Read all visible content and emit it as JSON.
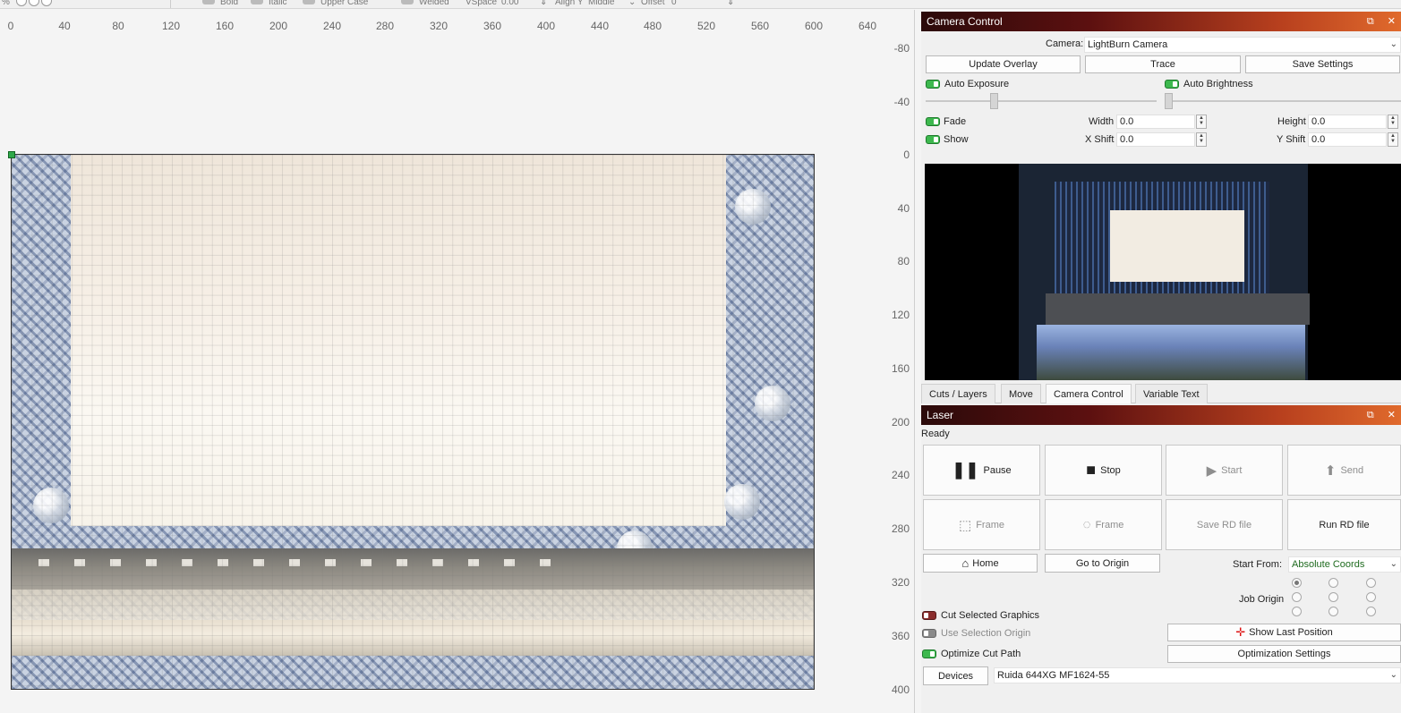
{
  "toolbar": {
    "bold": "Bold",
    "italic": "Italic",
    "upper_case": "Upper Case",
    "welded": "Welded",
    "vspace_label": "VSpace",
    "vspace_value": "0.00",
    "align_y_label": "Align Y",
    "align_y_value": "Middle",
    "offset_label": "Offset",
    "offset_value": "0"
  },
  "ruler_x": [
    "0",
    "40",
    "80",
    "120",
    "160",
    "200",
    "240",
    "280",
    "320",
    "360",
    "400",
    "440",
    "480",
    "520",
    "560",
    "600",
    "640"
  ],
  "ruler_y": [
    "-80",
    "-40",
    "0",
    "40",
    "80",
    "120",
    "160",
    "200",
    "240",
    "280",
    "320",
    "360",
    "400"
  ],
  "camera_control": {
    "title": "Camera Control",
    "camera_label": "Camera:",
    "camera_value": "LightBurn Camera",
    "update_overlay": "Update Overlay",
    "trace": "Trace",
    "save_settings": "Save Settings",
    "auto_exposure": "Auto Exposure",
    "auto_brightness": "Auto Brightness",
    "fade": "Fade",
    "show": "Show",
    "width_label": "Width",
    "width_value": "0.0",
    "height_label": "Height",
    "height_value": "0.0",
    "xshift_label": "X Shift",
    "xshift_value": "0.0",
    "yshift_label": "Y Shift",
    "yshift_value": "0.0"
  },
  "tabs": [
    "Cuts / Layers",
    "Move",
    "Camera Control",
    "Variable Text"
  ],
  "laser": {
    "title": "Laser",
    "status": "Ready",
    "pause": "Pause",
    "stop": "Stop",
    "start": "Start",
    "send": "Send",
    "frame1": "Frame",
    "frame2": "Frame",
    "save_rd": "Save RD file",
    "run_rd": "Run RD file",
    "home": "Home",
    "go_to_origin": "Go to Origin",
    "start_from_label": "Start From:",
    "start_from_value": "Absolute Coords",
    "job_origin_label": "Job Origin",
    "cut_selected": "Cut Selected Graphics",
    "use_selection_origin": "Use Selection Origin",
    "optimize_cut_path": "Optimize Cut Path",
    "show_last_position": "Show Last Position",
    "optimization_settings": "Optimization Settings",
    "devices": "Devices",
    "device_value": "Ruida 644XG MF1624-55"
  },
  "icons": {
    "pause": "pause-icon",
    "stop": "stop-icon",
    "start": "play-icon",
    "send": "upload-icon",
    "frame": "frame-icon",
    "frame_circle": "circle-frame-icon",
    "home": "home-icon",
    "crosshair": "crosshair-icon"
  },
  "colors": {
    "title_gradient_start": "#2b0a0a",
    "title_gradient_end": "#e06a2c",
    "toggle_on": "#3db84e",
    "toggle_red": "#8a2d2d"
  }
}
